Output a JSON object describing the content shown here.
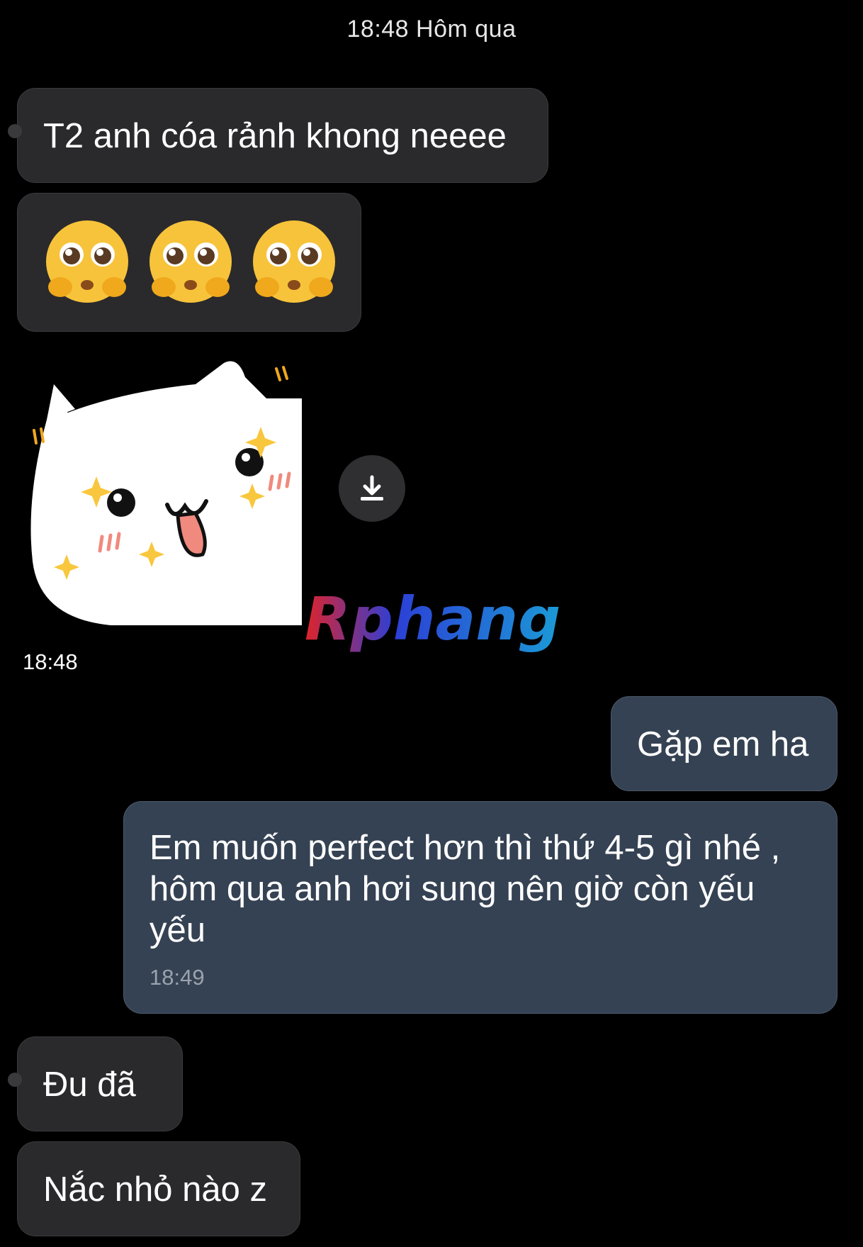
{
  "header": {
    "date_label": "18:48 Hôm qua"
  },
  "messages": [
    {
      "side": "incoming",
      "text": "T2 anh cóa rảnh khong neeee"
    },
    {
      "side": "incoming",
      "emoji": [
        "pleading-face",
        "pleading-face",
        "pleading-face"
      ]
    },
    {
      "side": "incoming",
      "sticker": "cat-sticker-sparkles",
      "time": "18:48"
    },
    {
      "side": "outgoing",
      "text": "Gặp em ha"
    },
    {
      "side": "outgoing",
      "text": "Em muốn perfect hơn thì thứ 4-5 gì nhé , hôm qua anh hơi sung nên giờ còn yếu yếu",
      "time": "18:49"
    },
    {
      "side": "incoming",
      "text": "Đu đã"
    },
    {
      "side": "incoming",
      "text": "Nắc nhỏ nào z"
    }
  ],
  "watermark": {
    "text": "Rphang"
  },
  "icons": {
    "download": "download-icon"
  },
  "colors": {
    "background": "#000000",
    "incoming_bubble": "#2a2a2c",
    "outgoing_bubble": "#354253",
    "timestamp": "#9aa3ad"
  }
}
